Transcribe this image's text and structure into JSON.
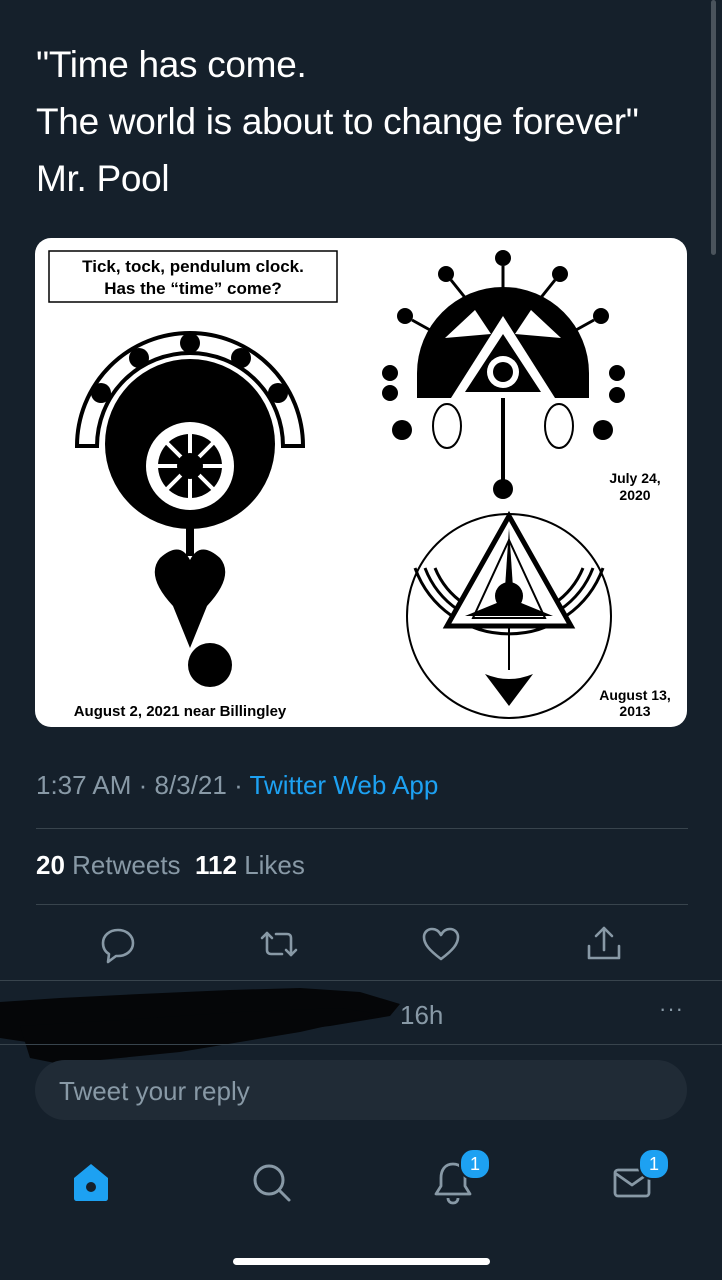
{
  "tweet": {
    "lines": [
      "\"Time has come.",
      "The world is about to change forever\"",
      "Mr. Pool"
    ],
    "time": "1:37 AM",
    "date": "8/3/21",
    "separator": "·",
    "app": "Twitter Web App"
  },
  "image": {
    "caption_box": [
      "Tick, tock, pendulum clock.",
      "Has the “time” come?"
    ],
    "label_left": "August 2, 2021 near Billingley",
    "label_top_right": [
      "July 24,",
      "2020"
    ],
    "label_bottom_right": [
      "August 13,",
      "2013"
    ]
  },
  "stats": {
    "retweets_count": "20",
    "retweets_label": "Retweets",
    "likes_count": "112",
    "likes_label": "Likes"
  },
  "reply_preview": {
    "time": "16h",
    "more": "···"
  },
  "reply_input": {
    "placeholder": "Tweet your reply"
  },
  "tabbar": {
    "notifications_badge": "1",
    "messages_badge": "1"
  },
  "colors": {
    "background": "#15202b",
    "accent": "#1da1f2",
    "muted": "#8899a6",
    "divider": "#38444d"
  }
}
